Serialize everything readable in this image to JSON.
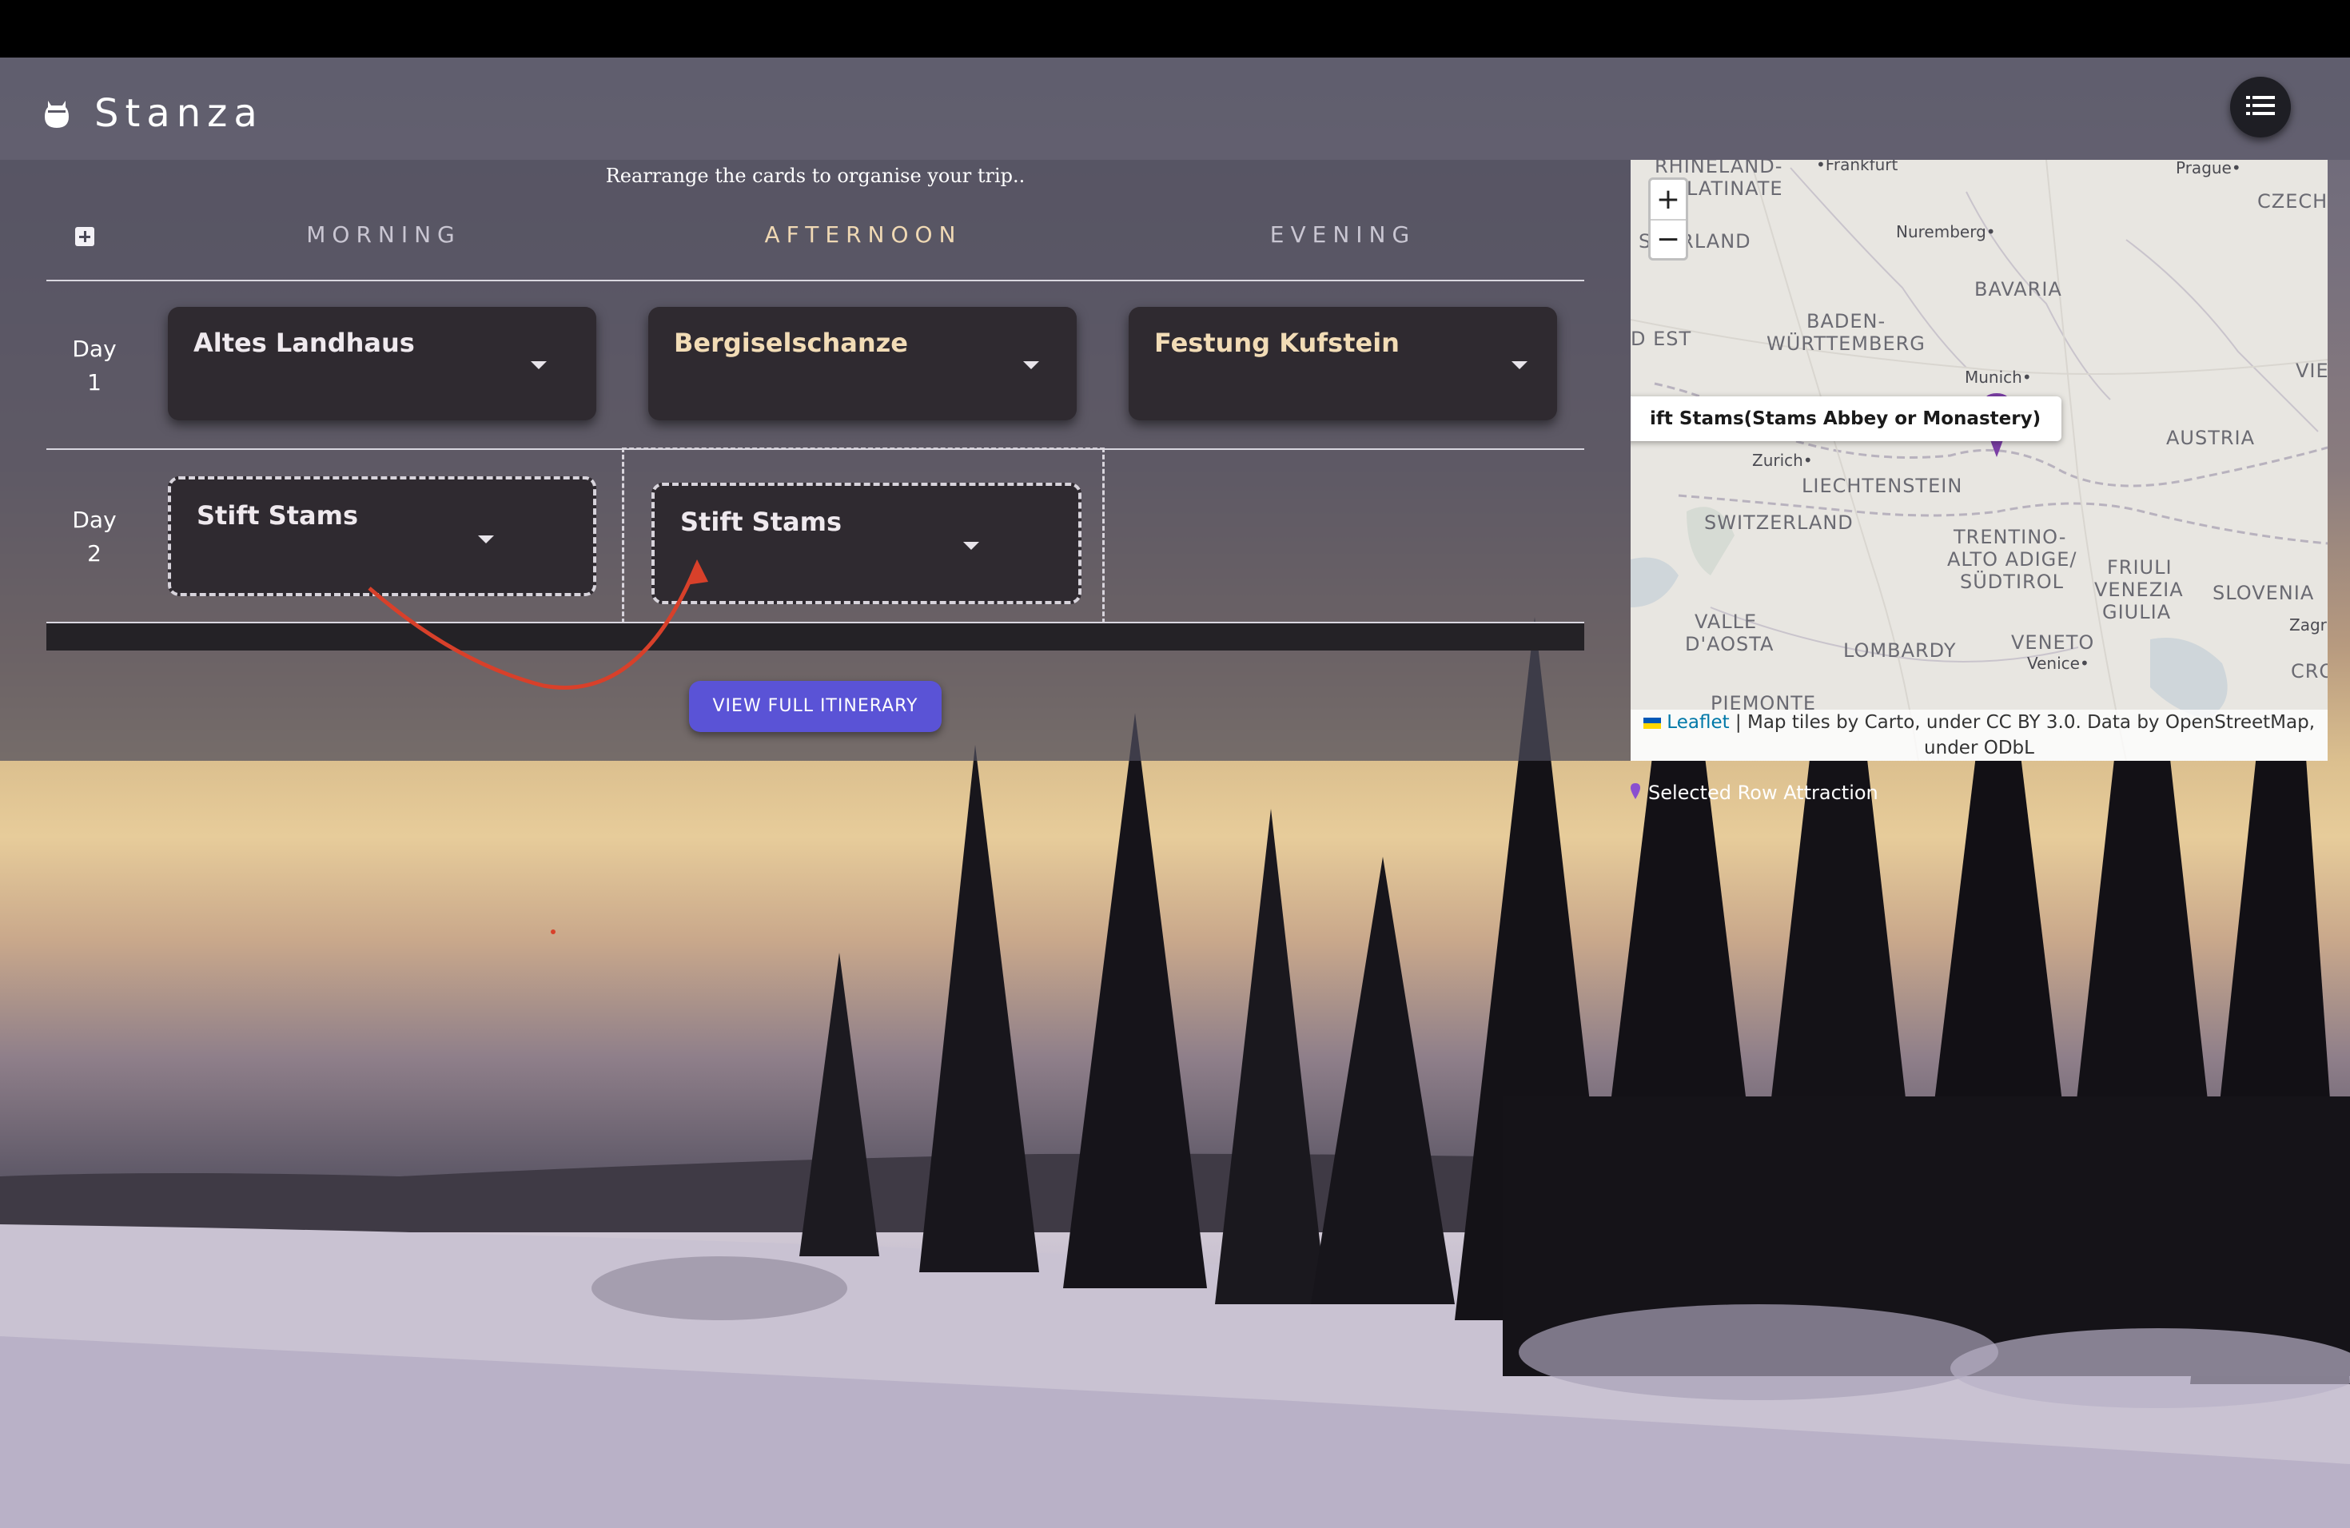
{
  "app": {
    "name": "Stanza"
  },
  "planner": {
    "hint": "Rearrange the cards to organise your trip..",
    "columns": {
      "morning": "MORNING",
      "afternoon": "AFTERNOON",
      "evening": "EVENING"
    },
    "days": [
      {
        "day_word": "Day",
        "day_number": "1",
        "morning": "Altes Landhaus",
        "afternoon": "Bergiselschanze",
        "evening": "Festung Kufstein"
      },
      {
        "day_word": "Day",
        "day_number": "2",
        "morning": "Stift Stams",
        "afternoon": "Stift Stams",
        "evening": ""
      }
    ],
    "view_button": "VIEW FULL ITINERARY"
  },
  "map": {
    "zoom_in": "+",
    "zoom_out": "−",
    "tooltip": "ift Stams(Stams Abbey or Monastery)",
    "regions": {
      "rhineland_1": "RHINELAND-",
      "rhineland_2": "LATINATE",
      "saarland": "SAARLAND",
      "czech": "CZECH",
      "bavaria": "BAVARIA",
      "baden_1": "BADEN-",
      "baden_2": "WÜRTTEMBERG",
      "grand_est": "D EST",
      "vie": "VIE",
      "austria": "AUSTRIA",
      "liechtenstein": "LIECHTENSTEIN",
      "switzerland": "SWITZERLAND",
      "trentino_1": "TRENTINO-",
      "trentino_2": "ALTO ADIGE/",
      "trentino_3": "SÜDTIROL",
      "friuli_1": "FRIULI",
      "friuli_2": "VENEZIA",
      "friuli_3": "GIULIA",
      "slovenia": "SLOVENIA",
      "valle_1": "VALLE",
      "valle_2": "D'AOSTA",
      "lombardy": "LOMBARDY",
      "veneto": "VENETO",
      "piemonte": "PIEMONTE",
      "cro": "CRO"
    },
    "cities": {
      "frankfurt": "•Frankfurt",
      "prague": "Prague•",
      "nuremberg": "Nuremberg•",
      "munich": "Munich•",
      "zurich": "Zurich•",
      "venice": "Venice•",
      "zagreb": "Zagr"
    },
    "attribution": {
      "leaflet": "Leaflet",
      "line1": " | Map tiles by Carto, under CC BY 3.0. Data by OpenStreetMap,",
      "line2": "under ODbL"
    },
    "legend": "Selected Row Attraction",
    "marker_color": "#7b3fa5"
  },
  "colors": {
    "accent": "#5a53d6",
    "card": "#2f2a30",
    "afternoon_heading": "#f0d9b4",
    "arrow": "#d8402a"
  }
}
